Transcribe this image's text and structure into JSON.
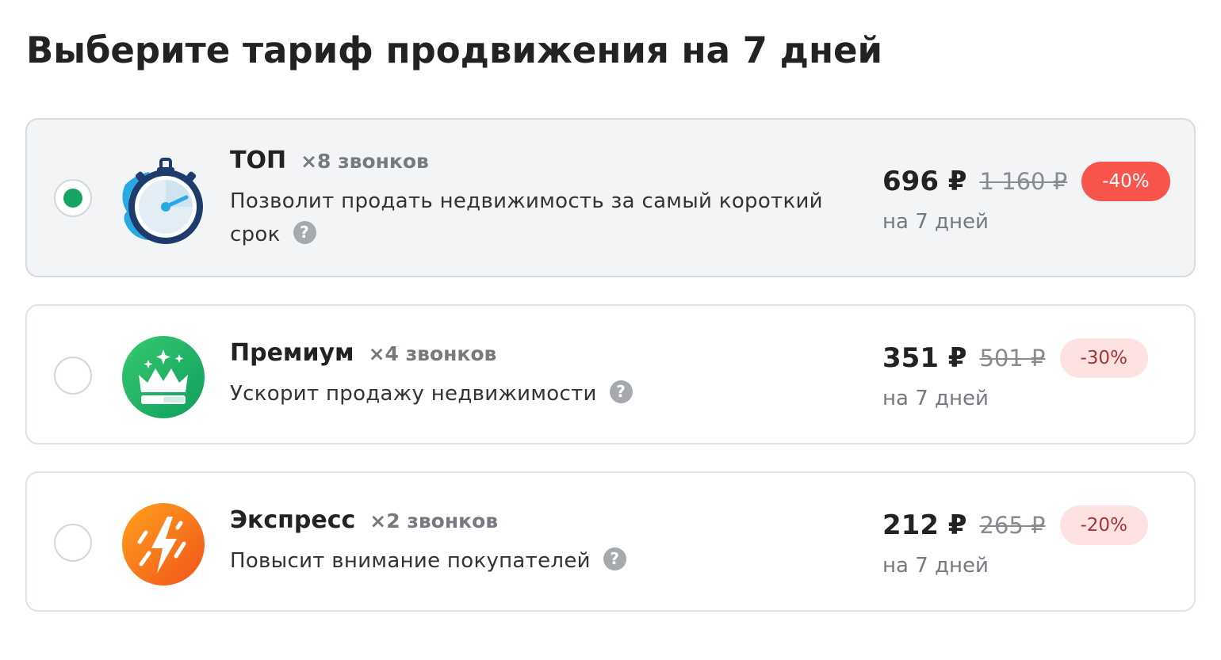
{
  "page": {
    "title": "Выберите тариф продвижения на 7 дней"
  },
  "tariffs": [
    {
      "name": "ТОП",
      "calls": "×8 звонков",
      "description": "Позволит продать недвижимость за самый короткий срок",
      "price": "696 ₽",
      "old_price": "1 160 ₽",
      "discount": "-40%",
      "period": "на 7 дней",
      "selected": true,
      "icon": "stopwatch-icon"
    },
    {
      "name": "Премиум",
      "calls": "×4 звонков",
      "description": "Ускорит продажу недвижимости",
      "price": "351 ₽",
      "old_price": "501 ₽",
      "discount": "-30%",
      "period": "на 7 дней",
      "selected": false,
      "icon": "crown-icon"
    },
    {
      "name": "Экспресс",
      "calls": "×2 звонков",
      "description": "Повысит внимание покупателей",
      "price": "212 ₽",
      "old_price": "265 ₽",
      "discount": "-20%",
      "period": "на 7 дней",
      "selected": false,
      "icon": "lightning-icon"
    }
  ],
  "help_icon": {
    "glyph": "?",
    "icon": "question-mark-icon"
  },
  "colors": {
    "selected_radio": "#19a463",
    "discount_strong": "#f7544c",
    "discount_soft_bg": "#fde2e1",
    "discount_soft_text": "#a8362f"
  }
}
